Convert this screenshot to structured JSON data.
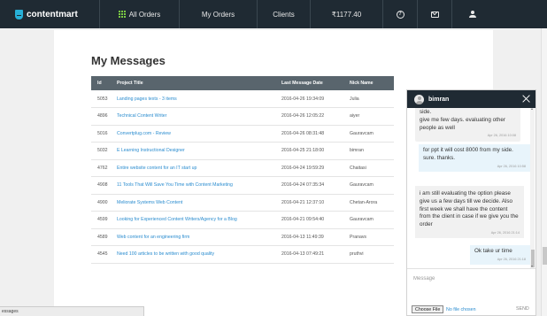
{
  "navbar": {
    "brand": "contentmart",
    "all_orders": "All Orders",
    "my_orders": "My Orders",
    "clients": "Clients",
    "balance": "₹1177.40",
    "help_icon_glyph": "?"
  },
  "page": {
    "title": "My Messages"
  },
  "table": {
    "headers": [
      "Id",
      "Project Title",
      "Last Message Date",
      "Nick Name"
    ],
    "rows": [
      [
        "5053",
        "Landing pages texts - 3 items",
        "2016-04-26 19:34:09",
        "Julia"
      ],
      [
        "4896",
        "Technical Content Writer",
        "2016-04-26 12:05:22",
        "aiyer"
      ],
      [
        "5016",
        "Convertplug.com - Review",
        "2016-04-26 08:31:48",
        "Gauravcam"
      ],
      [
        "5032",
        "E Learning Instructional Designer",
        "2016-04-25 21:18:00",
        "bimran"
      ],
      [
        "4762",
        "Entire website content for an IT start up",
        "2016-04-24 19:59:29",
        "Chaitasi"
      ],
      [
        "4908",
        "11 Tools That Will Save You Time with Content Marketing",
        "2016-04-24 07:35:34",
        "Gauravcam"
      ],
      [
        "4900",
        "Meliorate Systems Web Content",
        "2016-04-21 12:37:10",
        "Chetan-Arora"
      ],
      [
        "4599",
        "Looking for Experienced Content Writers/Agency for a Blog",
        "2016-04-21 09:54:40",
        "Gauravcam"
      ],
      [
        "4589",
        "Web content for an engineering firm",
        "2016-04-13 11:49:39",
        "Pranavs"
      ],
      [
        "4545",
        "Need 100 articles to be written with good quality",
        "2016-04-13 07:49:21",
        "pruthvi"
      ]
    ]
  },
  "statusbar": {
    "text": "essages"
  },
  "chat": {
    "contact": "bimran",
    "messages": [
      {
        "direction": "in",
        "text": "side.\ngive me few days. evaluating other people as well",
        "time": "Apr 26, 2016 10:08"
      },
      {
        "direction": "out",
        "text": "for ppt it will cost 8000 from my side.\nsure. thanks.",
        "time": "Apr 26, 2016 10:58"
      },
      {
        "direction": "in",
        "text": "i am still evaluating the option please give us a few days till we decide. Also first week we shall have the content from the client in case if we give you the order",
        "time": "Apr 26, 2016 21:14"
      },
      {
        "direction": "out",
        "text": "Ok take ur time",
        "time": "Apr 26, 2016 21:18"
      }
    ],
    "input_placeholder": "Message",
    "file_button": "Choose File",
    "file_status": "No file chosen",
    "send": "SEND"
  },
  "colors": {
    "navbar_bg": "#1f2a33",
    "table_header_bg": "#59656d",
    "link": "#2a8ccf",
    "brand_accent": "#27b0d8",
    "grid_icon": "#7ac943"
  },
  "icons": {
    "brand": "contentmart-logo-icon",
    "all_orders": "grid-icon",
    "help": "help-circle-icon",
    "messages": "envelope-icon",
    "profile": "user-icon",
    "chat_avatar": "avatar-icon",
    "chat_close": "close-icon"
  }
}
